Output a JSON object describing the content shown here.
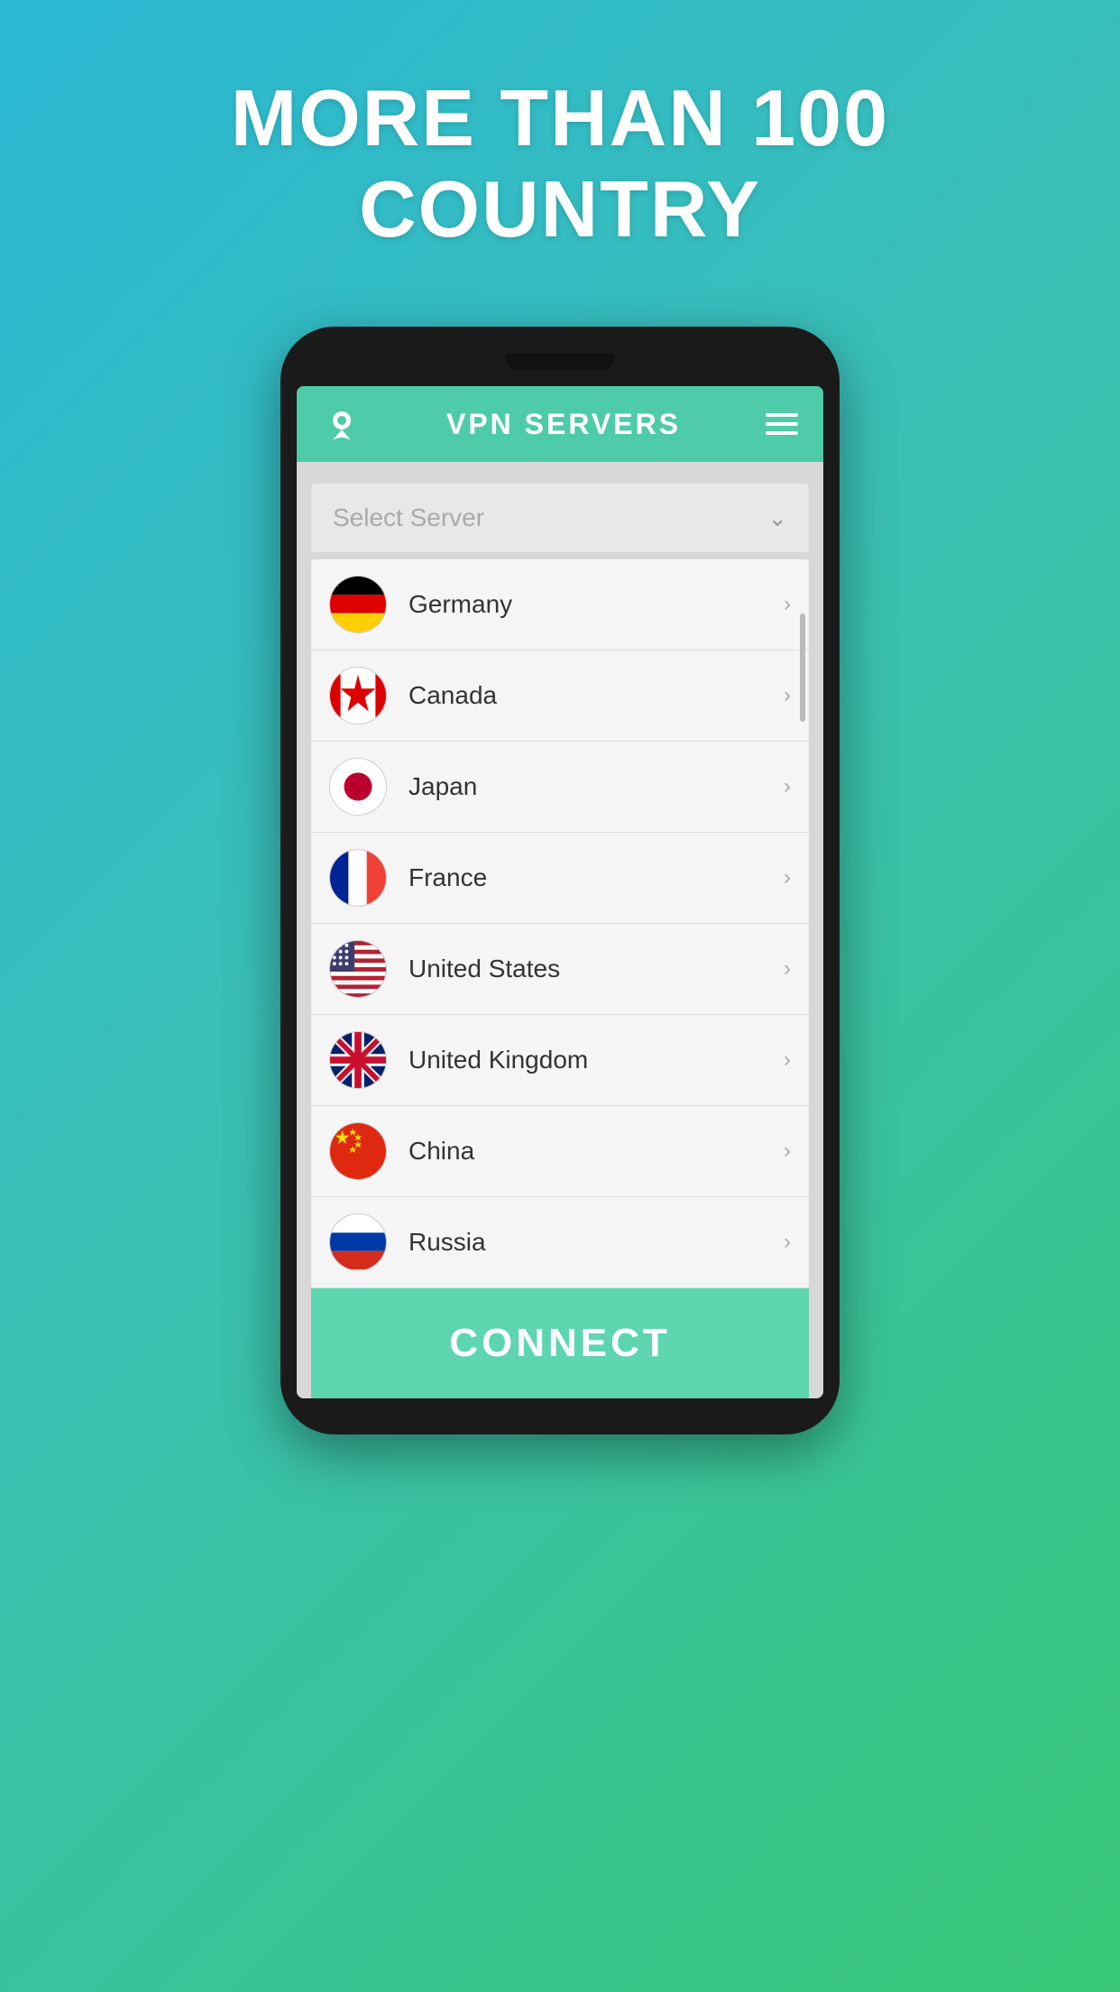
{
  "hero": {
    "line1": "MORE THAN 100",
    "line2": "COUNTRY"
  },
  "app": {
    "title": "VPN SERVERS",
    "icon": "location-pin",
    "menu_icon": "hamburger"
  },
  "select_server": {
    "placeholder": "Select Server",
    "chevron": "▾"
  },
  "countries": [
    {
      "name": "Germany",
      "code": "de"
    },
    {
      "name": "Canada",
      "code": "ca"
    },
    {
      "name": "Japan",
      "code": "jp"
    },
    {
      "name": "France",
      "code": "fr"
    },
    {
      "name": "United States",
      "code": "us"
    },
    {
      "name": "United Kingdom",
      "code": "gb"
    },
    {
      "name": "China",
      "code": "cn"
    },
    {
      "name": "Russia",
      "code": "ru"
    }
  ],
  "connect_button": {
    "label": "CONNECT"
  },
  "colors": {
    "accent": "#4ecba8",
    "background_gradient_start": "#2ab8d4",
    "background_gradient_end": "#3ac878",
    "connect_btn": "#5dd6b0"
  }
}
